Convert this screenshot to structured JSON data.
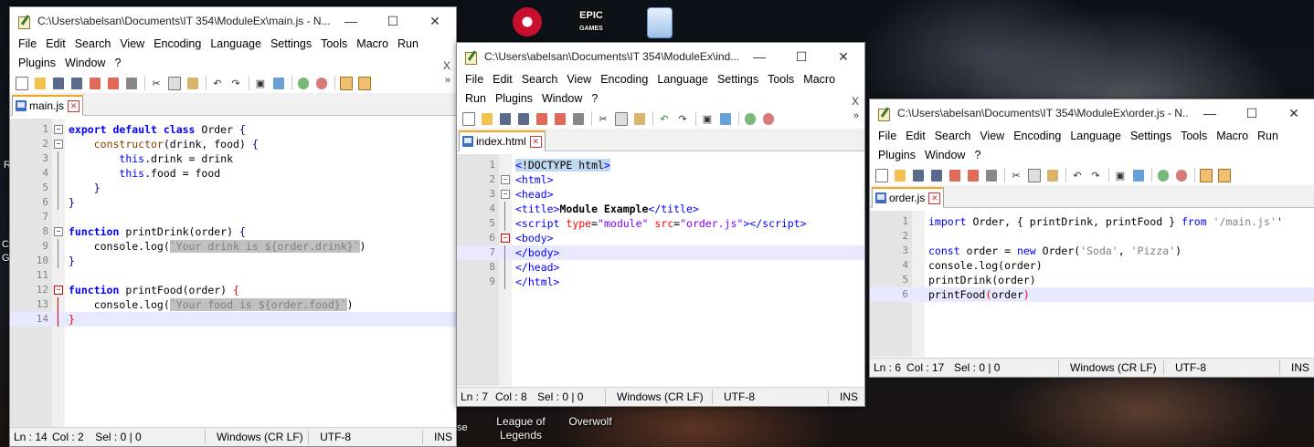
{
  "desktop": {
    "icons": [
      {
        "label": "",
        "color": "#c8102e",
        "name": "valorant-like-icon"
      },
      {
        "label": "EPIC\nGAMES",
        "color": "#111111",
        "name": "epic-games-icon"
      },
      {
        "label": "",
        "color": "#4a8fd8",
        "name": "recycle-bin-icon"
      }
    ],
    "bottom_icons": [
      {
        "label": "League of Legends"
      },
      {
        "label": "Overwolf"
      }
    ],
    "edge_texts": [
      "R",
      "C",
      "G",
      "se"
    ]
  },
  "menus": {
    "file": "File",
    "edit": "Edit",
    "search": "Search",
    "view": "View",
    "encoding": "Encoding",
    "language": "Language",
    "settings": "Settings",
    "tools": "Tools",
    "macro": "Macro",
    "run": "Run",
    "plugins": "Plugins",
    "window": "Window",
    "help": "?",
    "close": "X"
  },
  "win1": {
    "title": "C:\\Users\\abelsan\\Documents\\IT 354\\ModuleEx\\main.js - N...",
    "tab": "main.js",
    "lines": [
      {
        "n": "1",
        "html": "<span class='kw'>export default class</span> Order <span class='br'>{</span>"
      },
      {
        "n": "2",
        "html": "    <span style='color:#804000'>constructor</span>(drink, food) <span class='br'>{</span>"
      },
      {
        "n": "3",
        "html": "        <span style='color:#0000ff'>this</span>.drink = drink"
      },
      {
        "n": "4",
        "html": "        <span style='color:#0000ff'>this</span>.food = food"
      },
      {
        "n": "5",
        "html": "    <span class='br'>}</span>"
      },
      {
        "n": "6",
        "html": "<span class='br'>}</span>"
      },
      {
        "n": "7",
        "html": ""
      },
      {
        "n": "8",
        "html": "<span class='kw'>function</span> printDrink(order) <span class='br'>{</span>"
      },
      {
        "n": "9",
        "html": "    console.log(<span class='str'>`Your drink is ${order.drink}`</span>)"
      },
      {
        "n": "10",
        "html": "<span class='br'>}</span>"
      },
      {
        "n": "11",
        "html": ""
      },
      {
        "n": "12",
        "html": "<span class='kw'>function</span> printFood(order) <span class='red'>{</span>"
      },
      {
        "n": "13",
        "html": "    console.log(<span class='str'>`Your food is ${order.food}`</span>)"
      },
      {
        "n": "14",
        "html": "<span class='red'>}</span>"
      }
    ],
    "status": {
      "ln": "Ln : 14",
      "col": "Col : 2",
      "sel": "Sel : 0 | 0",
      "eol": "Windows (CR LF)",
      "enc": "UTF-8",
      "ins": "INS"
    }
  },
  "win2": {
    "title": "C:\\Users\\abelsan\\Documents\\IT 354\\ModuleEx\\ind...",
    "tab": "index.html",
    "lines": [
      {
        "n": "1",
        "html": "<span style='background:#c0d8f0'><span class='tg'>&lt;</span>!DOCTYPE html<span class='tg'>&gt;</span></span>"
      },
      {
        "n": "2",
        "html": "<span class='tg'>&lt;html&gt;</span>"
      },
      {
        "n": "3",
        "html": "<span class='tg'>&lt;head&gt;</span>"
      },
      {
        "n": "4",
        "html": "<span class='tg'>&lt;title&gt;</span><b>Module Example</b><span class='tg'>&lt;/title&gt;</span>"
      },
      {
        "n": "5",
        "html": "<span class='tg'>&lt;script</span> <span class='at'>type</span>=<span class='av'>\"module\"</span> <span class='at'>src</span>=<span class='av'>\"order.js\"</span><span class='tg'>&gt;&lt;/script&gt;</span>"
      },
      {
        "n": "6",
        "html": "<span class='tg'>&lt;body&gt;</span>"
      },
      {
        "n": "7",
        "html": "<span class='tg'>&lt;/body&gt;</span>"
      },
      {
        "n": "8",
        "html": "<span class='tg'>&lt;/head&gt;</span>"
      },
      {
        "n": "9",
        "html": "<span class='tg'>&lt;/html&gt;</span>"
      }
    ],
    "status": {
      "ln": "Ln : 7",
      "col": "Col : 8",
      "sel": "Sel : 0 | 0",
      "eol": "Windows (CR LF)",
      "enc": "UTF-8",
      "ins": "INS"
    }
  },
  "win3": {
    "title": "C:\\Users\\abelsan\\Documents\\IT 354\\ModuleEx\\order.js - N...",
    "tab": "order.js",
    "lines": [
      {
        "n": "1",
        "html": "<span style='color:#0000ff'>import</span> Order, { printDrink, printFood } <span style='color:#0000ff'>from</span> <span class='str2'>'/main.js'</span>'"
      },
      {
        "n": "2",
        "html": ""
      },
      {
        "n": "3",
        "html": "<span style='color:#0000ff'>const</span> order = <span style='color:#0000ff'>new</span> Order(<span class='str2'>'Soda'</span>, <span class='str2'>'Pizza'</span>)"
      },
      {
        "n": "4",
        "html": "console.log(order)"
      },
      {
        "n": "5",
        "html": "printDrink(order)"
      },
      {
        "n": "6",
        "html": "printFood<span class='red'>(</span>order<span class='red'>)</span>"
      }
    ],
    "status": {
      "ln": "Ln : 6",
      "col": "Col : 17",
      "sel": "Sel : 0 | 0",
      "eol": "Windows (CR LF)",
      "enc": "UTF-8",
      "ins": "INS"
    }
  }
}
